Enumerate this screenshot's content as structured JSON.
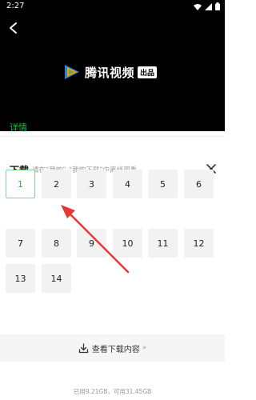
{
  "status": {
    "time": "2:27"
  },
  "logo": {
    "text": "腾讯视频",
    "badge": "出品"
  },
  "tabs": {
    "details": "详情"
  },
  "download": {
    "title": "下载",
    "hint": "请在“我的”-“我的下载”中离线观看"
  },
  "episodes": [
    "1",
    "2",
    "3",
    "4",
    "5",
    "6",
    "7",
    "8",
    "9",
    "10",
    "11",
    "12",
    "13",
    "14"
  ],
  "selected_episode": "1",
  "bottom": {
    "view_downloads": "查看下载内容",
    "chevron": "»"
  },
  "storage": {
    "text": "已用9.21GB，可用31.45GB"
  },
  "colors": {
    "accent": "#23b74f",
    "arrow": "#e53935"
  }
}
